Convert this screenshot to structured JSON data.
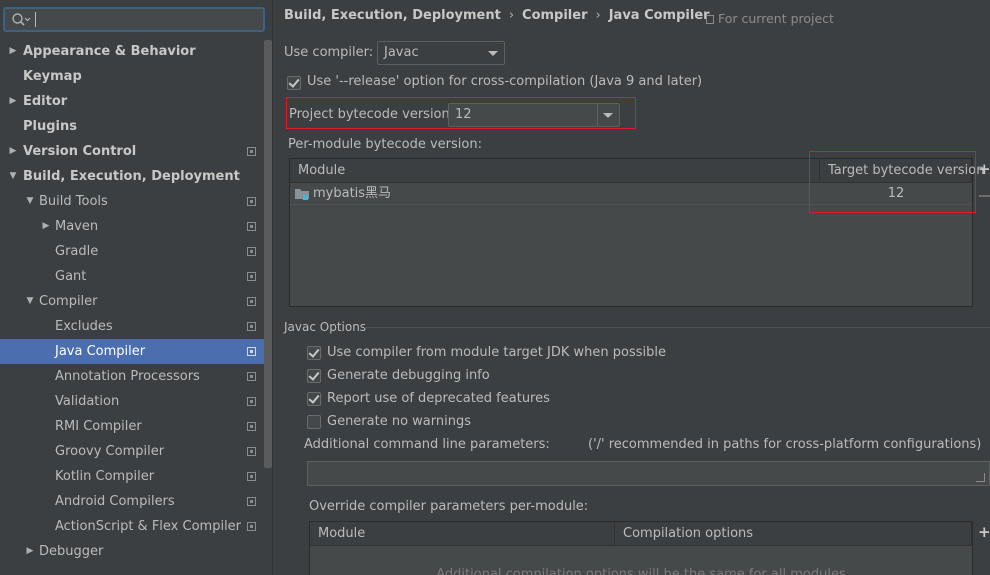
{
  "search": {
    "value": "",
    "placeholder": ""
  },
  "sidebar": {
    "items": [
      {
        "label": "Appearance & Behavior",
        "bold": true,
        "arrow": "▶",
        "indent": 0,
        "proj": false
      },
      {
        "label": "Keymap",
        "bold": true,
        "arrow": "",
        "indent": 0,
        "proj": false
      },
      {
        "label": "Editor",
        "bold": true,
        "arrow": "▶",
        "indent": 0,
        "proj": false
      },
      {
        "label": "Plugins",
        "bold": true,
        "arrow": "",
        "indent": 0,
        "proj": false
      },
      {
        "label": "Version Control",
        "bold": true,
        "arrow": "▶",
        "indent": 0,
        "proj": true
      },
      {
        "label": "Build, Execution, Deployment",
        "bold": true,
        "arrow": "▼",
        "indent": 0,
        "proj": false
      },
      {
        "label": "Build Tools",
        "bold": false,
        "arrow": "▼",
        "indent": 1,
        "proj": true
      },
      {
        "label": "Maven",
        "bold": false,
        "arrow": "▶",
        "indent": 2,
        "proj": true
      },
      {
        "label": "Gradle",
        "bold": false,
        "arrow": "",
        "indent": 2,
        "proj": true
      },
      {
        "label": "Gant",
        "bold": false,
        "arrow": "",
        "indent": 2,
        "proj": true
      },
      {
        "label": "Compiler",
        "bold": false,
        "arrow": "▼",
        "indent": 1,
        "proj": true
      },
      {
        "label": "Excludes",
        "bold": false,
        "arrow": "",
        "indent": 2,
        "proj": true
      },
      {
        "label": "Java Compiler",
        "bold": false,
        "arrow": "",
        "indent": 2,
        "proj": true,
        "selected": true
      },
      {
        "label": "Annotation Processors",
        "bold": false,
        "arrow": "",
        "indent": 2,
        "proj": true
      },
      {
        "label": "Validation",
        "bold": false,
        "arrow": "",
        "indent": 2,
        "proj": true
      },
      {
        "label": "RMI Compiler",
        "bold": false,
        "arrow": "",
        "indent": 2,
        "proj": true
      },
      {
        "label": "Groovy Compiler",
        "bold": false,
        "arrow": "",
        "indent": 2,
        "proj": true
      },
      {
        "label": "Kotlin Compiler",
        "bold": false,
        "arrow": "",
        "indent": 2,
        "proj": true
      },
      {
        "label": "Android Compilers",
        "bold": false,
        "arrow": "",
        "indent": 2,
        "proj": true
      },
      {
        "label": "ActionScript & Flex Compiler",
        "bold": false,
        "arrow": "",
        "indent": 2,
        "proj": true
      },
      {
        "label": "Debugger",
        "bold": false,
        "arrow": "▶",
        "indent": 1,
        "proj": false
      }
    ]
  },
  "breadcrumb": {
    "items": [
      "Build, Execution, Deployment",
      "Compiler",
      "Java Compiler"
    ],
    "separator": "›",
    "for_project": "For current project"
  },
  "compiler": {
    "use_compiler_label": "Use compiler:",
    "use_compiler_value": "Javac",
    "release_option_label": "Use '--release' option for cross-compilation (Java 9 and later)",
    "release_option_checked": true,
    "bytecode_label": "Project bytecode version:",
    "bytecode_value": "12",
    "per_module_label": "Per-module bytecode version:"
  },
  "module_table": {
    "headers": [
      "Module",
      "Target bytecode version"
    ],
    "rows": [
      {
        "module": "mybatis黑马",
        "target": "12"
      }
    ],
    "add_button": "+",
    "remove_button": "—"
  },
  "javac": {
    "section_label": "Javac Options",
    "options": [
      {
        "label": "Use compiler from module target JDK when possible",
        "checked": true
      },
      {
        "label": "Generate debugging info",
        "checked": true
      },
      {
        "label": "Report use of deprecated features",
        "checked": true
      },
      {
        "label": "Generate no warnings",
        "checked": false
      }
    ],
    "params_label": "Additional command line parameters:",
    "params_hint": "('/' recommended in paths for cross-platform configurations)",
    "params_value": "",
    "override_label": "Override compiler parameters per-module:"
  },
  "override_table": {
    "headers": [
      "Module",
      "Compilation options"
    ],
    "empty_text": "Additional compilation options will be the same for all modules",
    "add_button": "+"
  },
  "colors": {
    "background": "#3c3f41",
    "selection": "#4b6eaf",
    "highlight_box": "#e01b24",
    "focus_border": "#3d6185"
  }
}
